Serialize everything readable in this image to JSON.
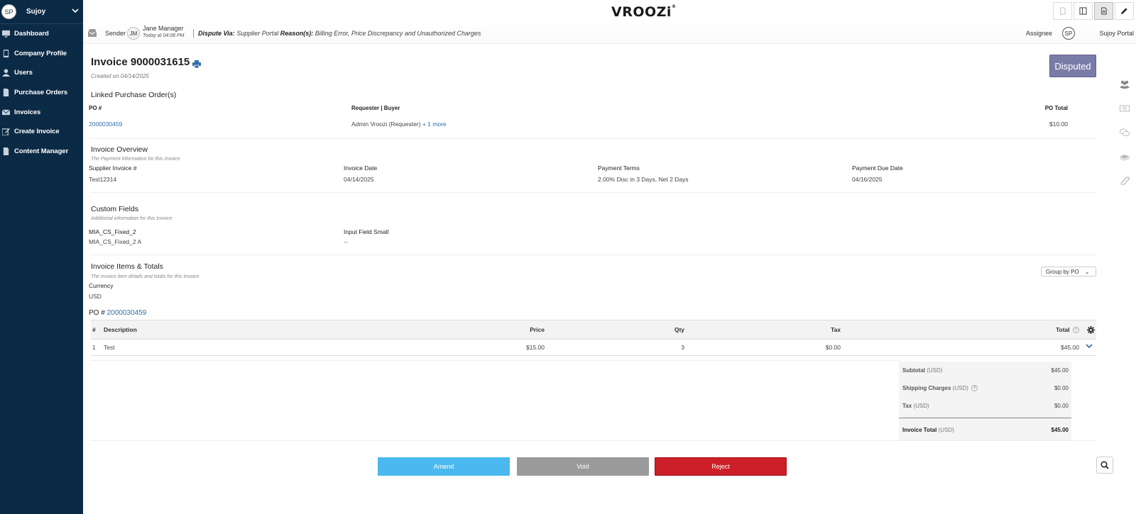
{
  "sidebar": {
    "avatar": "SP",
    "username": "Sujoy",
    "items": [
      {
        "label": "Dashboard",
        "icon": "monitor-icon"
      },
      {
        "label": "Company Profile",
        "icon": "tablet-icon"
      },
      {
        "label": "Users",
        "icon": "user-icon"
      },
      {
        "label": "Purchase Orders",
        "icon": "document-icon"
      },
      {
        "label": "Invoices",
        "icon": "envelope-icon"
      },
      {
        "label": "Create Invoice",
        "icon": "edit-icon"
      },
      {
        "label": "Content Manager",
        "icon": "file-icon"
      }
    ]
  },
  "header": {
    "logo": "VROOZi"
  },
  "dispute_bar": {
    "sender_label": "Sender",
    "sender_initials": "JM",
    "sender_name": "Jane Manager",
    "sender_time": "Today at 04:08 PM",
    "via_label": "Dispute Via:",
    "via_value": "Supplier Portal",
    "reasons_label": "Reason(s):",
    "reasons_value": "Billing Error, Price Discrepancy and Unauthorized Charges",
    "assignee_label": "Assignee",
    "assignee_initials": "SP",
    "assignee_name": "Sujoy Portal"
  },
  "invoice": {
    "title": "Invoice 9000031615",
    "created": "Created on 04/14/2025",
    "status": "Disputed"
  },
  "linked_po": {
    "title": "Linked Purchase Order(s)",
    "col_po": "PO #",
    "col_requester": "Requester | Buyer",
    "col_total": "PO Total",
    "po_number": "2000030459",
    "requester": "Admin Vroozi (Requester)",
    "more": "+ 1 more",
    "po_total": "$10.00"
  },
  "overview": {
    "title": "Invoice Overview",
    "subtitle": "The Payment Information for this Invoice",
    "fields": [
      {
        "label": "Supplier Invoice #",
        "value": "Test12314"
      },
      {
        "label": "Invoice Date",
        "value": "04/14/2025"
      },
      {
        "label": "Payment Terms",
        "value": "2.00% Disc in 3 Days, Net 2 Days"
      },
      {
        "label": "Payment Due Date",
        "value": "04/16/2025"
      }
    ]
  },
  "custom_fields": {
    "title": "Custom Fields",
    "subtitle": "Additional information for this Invoice",
    "fields": [
      {
        "label": "MIA_CS_Fixed_2",
        "value": "MIA_CS_Fixed_2 A"
      },
      {
        "label": "Input Field Small",
        "value": "--"
      }
    ]
  },
  "items": {
    "title": "Invoice Items & Totals",
    "subtitle": "The invoice item details and totals for this Invoice",
    "group_by": "Group by PO",
    "currency_label": "Currency",
    "currency_value": "USD",
    "po_prefix": "PO #",
    "po_number": "2000030459",
    "columns": {
      "num": "#",
      "description": "Description",
      "price": "Price",
      "qty": "Qty",
      "tax": "Tax",
      "total": "Total"
    },
    "rows": [
      {
        "num": "1",
        "description": "Test",
        "price": "$15.00",
        "qty": "3",
        "tax": "$0.00",
        "total": "$45.00"
      }
    ]
  },
  "totals": {
    "subtotal_label": "Subtotal",
    "subtotal_unit": "(USD)",
    "subtotal": "$45.00",
    "shipping_label": "Shipping Charges",
    "shipping_unit": "(USD)",
    "shipping": "$0.00",
    "tax_label": "Tax",
    "tax_unit": "(USD)",
    "tax": "$0.00",
    "total_label": "Invoice Total",
    "total_unit": "(USD)",
    "total": "$45.00"
  },
  "actions": {
    "amend": "Amend",
    "void": "Void",
    "reject": "Reject"
  }
}
